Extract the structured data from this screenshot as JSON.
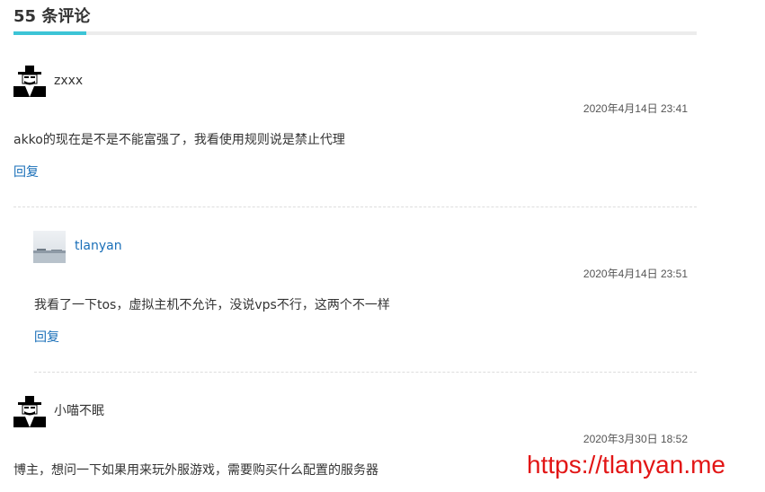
{
  "header": {
    "title": "55 条评论"
  },
  "comments": [
    {
      "author": "zxxx",
      "time": "2020年4月14日 23:41",
      "content": "akko的现在是不是不能富强了，我看使用规则说是禁止代理",
      "reply_label": "回复"
    },
    {
      "author": "tlanyan",
      "time": "2020年4月14日 23:51",
      "content": "我看了一下tos，虚拟主机不允许，没说vps不行，这两个不一样",
      "reply_label": "回复"
    },
    {
      "author": "小喵不眠",
      "time": "2020年3月30日 18:52",
      "content": "博主，想问一下如果用来玩外服游戏，需要购买什么配置的服务器"
    }
  ],
  "watermark": "https://tlanyan.me",
  "colors": {
    "accent": "#3cc4d6",
    "link": "#1a6fb8",
    "watermark": "#e21616"
  }
}
